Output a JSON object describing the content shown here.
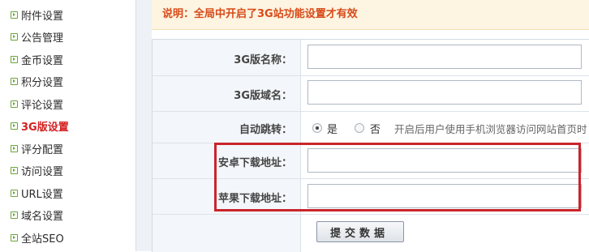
{
  "sidebar": {
    "items": [
      {
        "label": "附件设置",
        "active": false
      },
      {
        "label": "公告管理",
        "active": false
      },
      {
        "label": "金币设置",
        "active": false
      },
      {
        "label": "积分设置",
        "active": false
      },
      {
        "label": "评论设置",
        "active": false
      },
      {
        "label": "3G版设置",
        "active": true
      },
      {
        "label": "评分配置",
        "active": false
      },
      {
        "label": "访问设置",
        "active": false
      },
      {
        "label": "URL设置",
        "active": false
      },
      {
        "label": "域名设置",
        "active": false
      },
      {
        "label": "全站SEO",
        "active": false
      }
    ]
  },
  "notice": {
    "text": "说明：全局中开启了3G站功能设置才有效"
  },
  "form": {
    "name_label": "3G版名称：",
    "name_value": "",
    "domain_label": "3G版域名：",
    "domain_value": "",
    "redirect_label": "自动跳转：",
    "redirect_options": [
      {
        "label": "是",
        "checked": true
      },
      {
        "label": "否",
        "checked": false
      }
    ],
    "redirect_hint": "开启后用户使用手机浏览器访问网站首页时",
    "android_label": "安卓下载地址：",
    "android_value": "",
    "apple_label": "苹果下载地址：",
    "apple_value": "",
    "submit_label": "提交数据"
  },
  "colors": {
    "active_item": "#d41f1f",
    "notice_text": "#d84a18",
    "highlight_border": "#c9252b"
  }
}
